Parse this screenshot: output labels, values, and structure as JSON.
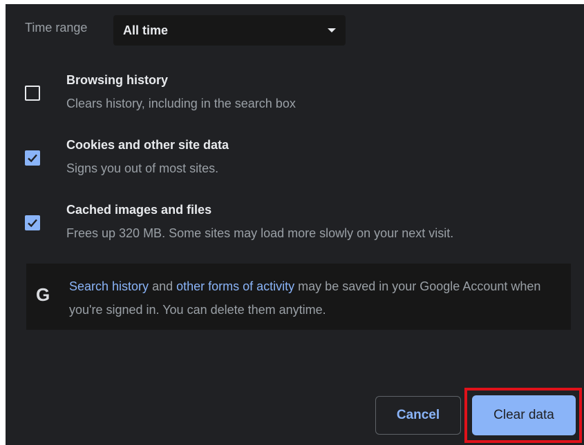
{
  "time_range": {
    "label": "Time range",
    "value": "All time"
  },
  "options": [
    {
      "title": "Browsing history",
      "description": "Clears history, including in the search box",
      "checked": false
    },
    {
      "title": "Cookies and other site data",
      "description": "Signs you out of most sites.",
      "checked": true
    },
    {
      "title": "Cached images and files",
      "description": "Frees up 320 MB. Some sites may load more slowly on your next visit.",
      "checked": true
    }
  ],
  "notice": {
    "icon": "google-g-icon",
    "link1": "Search history",
    "text1": " and ",
    "link2": "other forms of activity",
    "text2": " may be saved in your Google Account when you're signed in. You can delete them anytime."
  },
  "buttons": {
    "cancel": "Cancel",
    "clear": "Clear data"
  },
  "colors": {
    "background": "#202124",
    "accent": "#8ab4f8",
    "highlight": "#e0121a"
  }
}
